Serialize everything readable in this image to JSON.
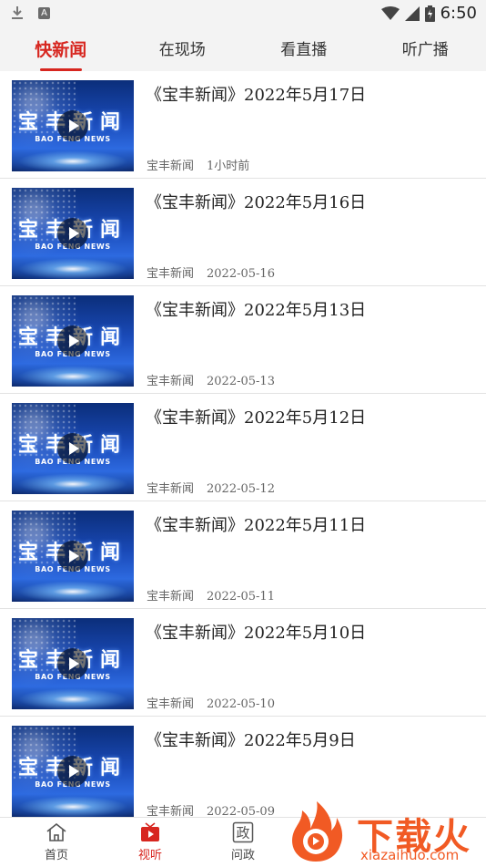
{
  "status_bar": {
    "time": "6:50",
    "notif_icons": [
      "download-icon",
      "a-icon"
    ],
    "notif_letter": "A"
  },
  "tabs": [
    {
      "label": "快新闻",
      "active": true
    },
    {
      "label": "在现场",
      "active": false
    },
    {
      "label": "看直播",
      "active": false
    },
    {
      "label": "听广播",
      "active": false
    }
  ],
  "thumbnail": {
    "title_cn": "宝丰新闻",
    "title_en": "BAO FENG NEWS"
  },
  "news": [
    {
      "title": "《宝丰新闻》2022年5月17日",
      "source": "宝丰新闻",
      "time": "1小时前"
    },
    {
      "title": "《宝丰新闻》2022年5月16日",
      "source": "宝丰新闻",
      "time": "2022-05-16"
    },
    {
      "title": "《宝丰新闻》2022年5月13日",
      "source": "宝丰新闻",
      "time": "2022-05-13"
    },
    {
      "title": "《宝丰新闻》2022年5月12日",
      "source": "宝丰新闻",
      "time": "2022-05-12"
    },
    {
      "title": "《宝丰新闻》2022年5月11日",
      "source": "宝丰新闻",
      "time": "2022-05-11"
    },
    {
      "title": "《宝丰新闻》2022年5月10日",
      "source": "宝丰新闻",
      "time": "2022-05-10"
    },
    {
      "title": "《宝丰新闻》2022年5月9日",
      "source": "宝丰新闻",
      "time": "2022-05-09"
    }
  ],
  "bottom_nav": [
    {
      "label": "首页",
      "icon": "home-icon",
      "active": false
    },
    {
      "label": "视听",
      "icon": "video-play-icon",
      "active": true
    },
    {
      "label": "问政",
      "icon": "zheng-icon",
      "glyph": "政",
      "active": false
    }
  ],
  "watermark": {
    "text": "下载火",
    "url": "xiazaihuo.com"
  },
  "colors": {
    "accent": "#d7261f",
    "watermark": "#f15a24",
    "bar_bg": "#f3f3f3"
  }
}
